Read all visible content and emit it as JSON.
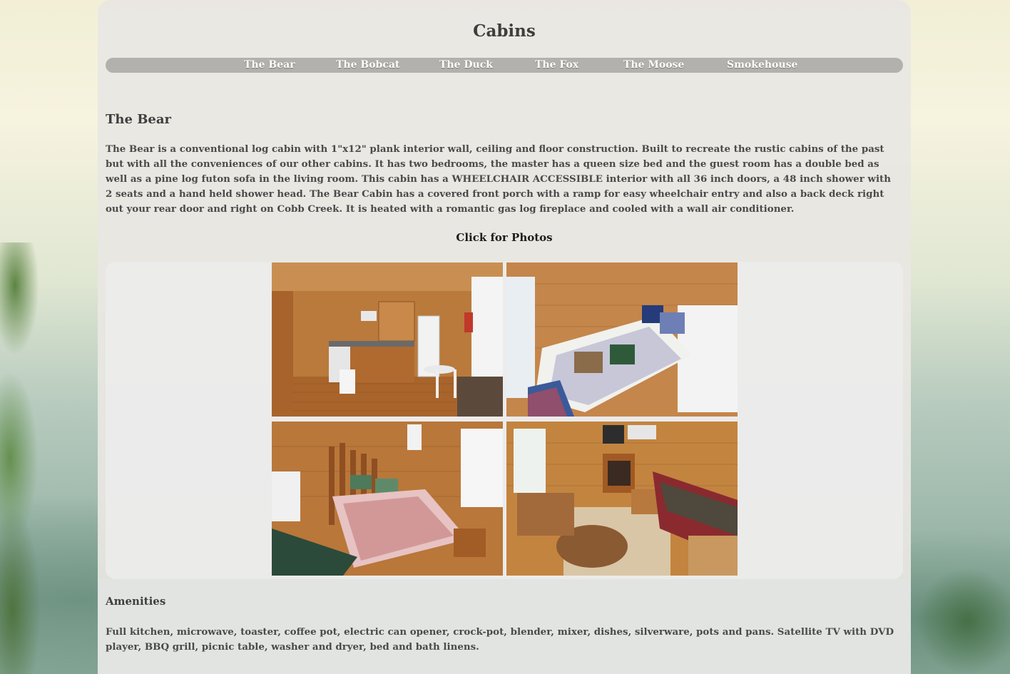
{
  "site": {
    "title": "Cabins"
  },
  "nav": {
    "items": [
      {
        "label": "The Bear"
      },
      {
        "label": "The Bobcat"
      },
      {
        "label": "The Duck"
      },
      {
        "label": "The Fox"
      },
      {
        "label": "The Moose"
      },
      {
        "label": "Smokehouse"
      }
    ]
  },
  "cabin": {
    "name": "The Bear",
    "description": "The Bear is a conventional log cabin with 1\"x12\" plank interior wall, ceiling and floor construction. Built to recreate the rustic cabins of the past but with all the conveniences of our other cabins. It has two bedrooms, the master has a queen size bed and the guest room has a double bed as well as a pine log futon sofa in the living room. This cabin has a WHEELCHAIR ACCESSIBLE interior with all 36 inch doors, a 48 inch shower with 2 seats and a hand held shower head. The Bear Cabin has a covered front porch with a ramp for easy wheelchair entry and also a back deck right out your rear door and right on Cobb Creek. It is heated with a romantic gas log fireplace and cooled with a wall air conditioner.",
    "photos_link": "Click for Photos"
  },
  "gallery": {
    "photos": [
      {
        "subject": "kitchen"
      },
      {
        "subject": "guest-bedroom"
      },
      {
        "subject": "master-bedroom"
      },
      {
        "subject": "living-room"
      }
    ]
  },
  "amenities": {
    "title": "Amenities",
    "text": "Full kitchen, microwave, toaster, coffee pot, electric can opener, crock-pot, blender, mixer, dishes, silverware, pots and pans. Satellite TV with DVD player, BBQ grill, picnic table, washer and dryer, bed and bath linens."
  }
}
